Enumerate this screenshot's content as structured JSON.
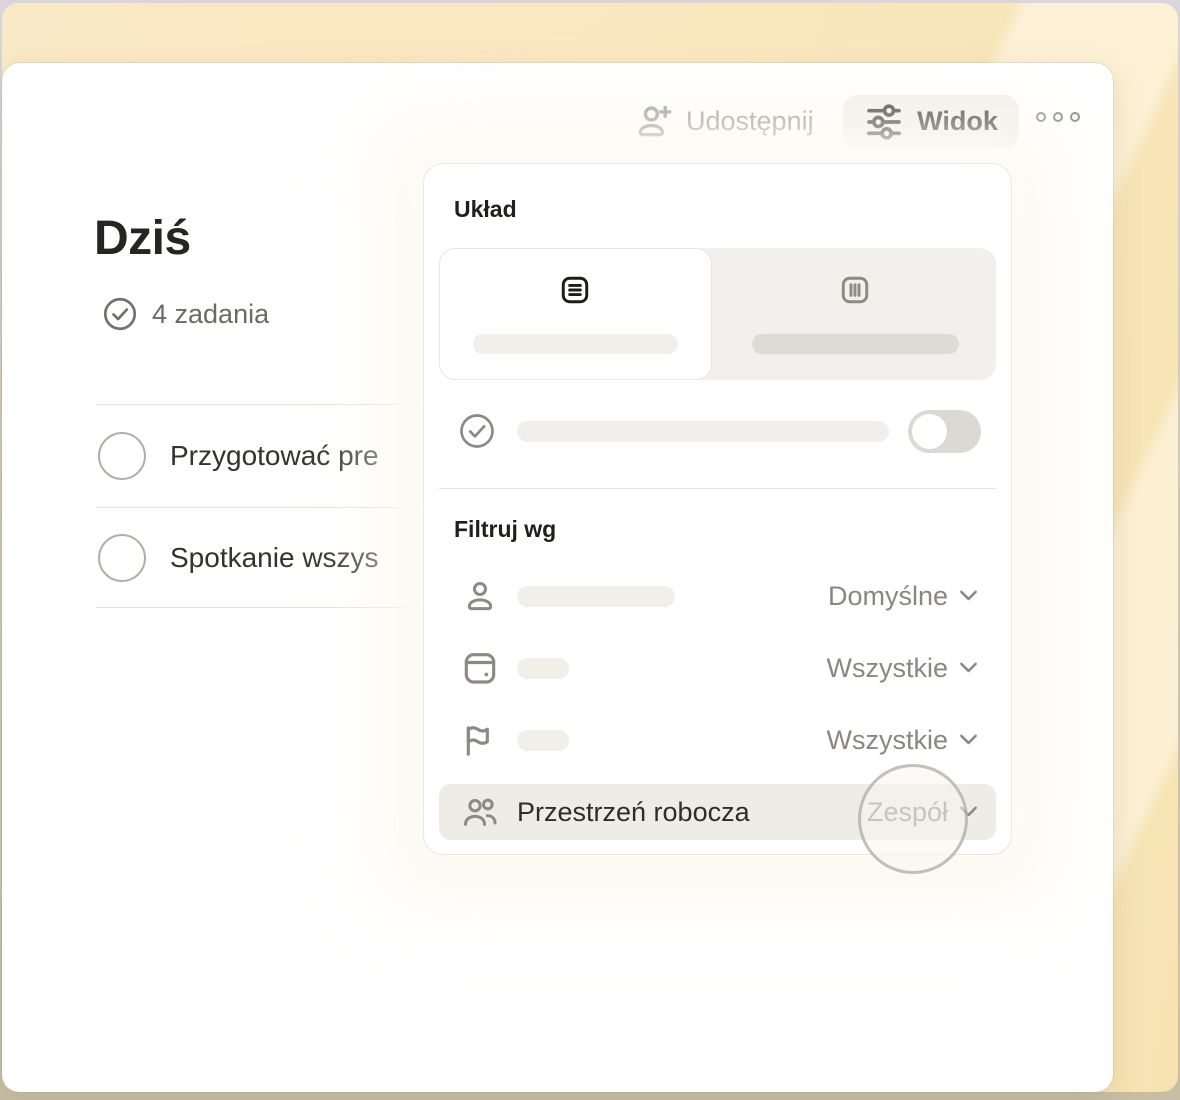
{
  "header": {
    "share_label": "Udostępnij",
    "view_label": "Widok"
  },
  "page": {
    "title": "Dziś",
    "task_count": "4 zadania"
  },
  "tasks": [
    {
      "label": "Przygotować pre"
    },
    {
      "label": "Spotkanie wszys"
    }
  ],
  "popup": {
    "layout_heading": "Układ",
    "filter_heading": "Filtruj wg",
    "filters": [
      {
        "icon": "person-icon",
        "value": "Domyślne"
      },
      {
        "icon": "calendar-icon",
        "value": "Wszystkie"
      },
      {
        "icon": "flag-icon",
        "value": "Wszystkie"
      },
      {
        "icon": "users-icon",
        "label": "Przestrzeń robocza",
        "value": "Zespół"
      }
    ]
  },
  "icons": {
    "share": "person-plus-icon",
    "view": "sliders-icon",
    "more": "ellipsis-icon",
    "count": "check-circle-icon",
    "layout_list": "list-layout-icon",
    "layout_board": "board-layout-icon",
    "toggle_row": "check-circle-icon"
  },
  "colors": {
    "background_yellow": "#F9E7BE",
    "card_white": "#FFFFFF",
    "pill_gray": "#F1F0EC",
    "muted_text": "#8B877F",
    "dark_text": "#272521",
    "highlight_row": "#EDECE7"
  }
}
